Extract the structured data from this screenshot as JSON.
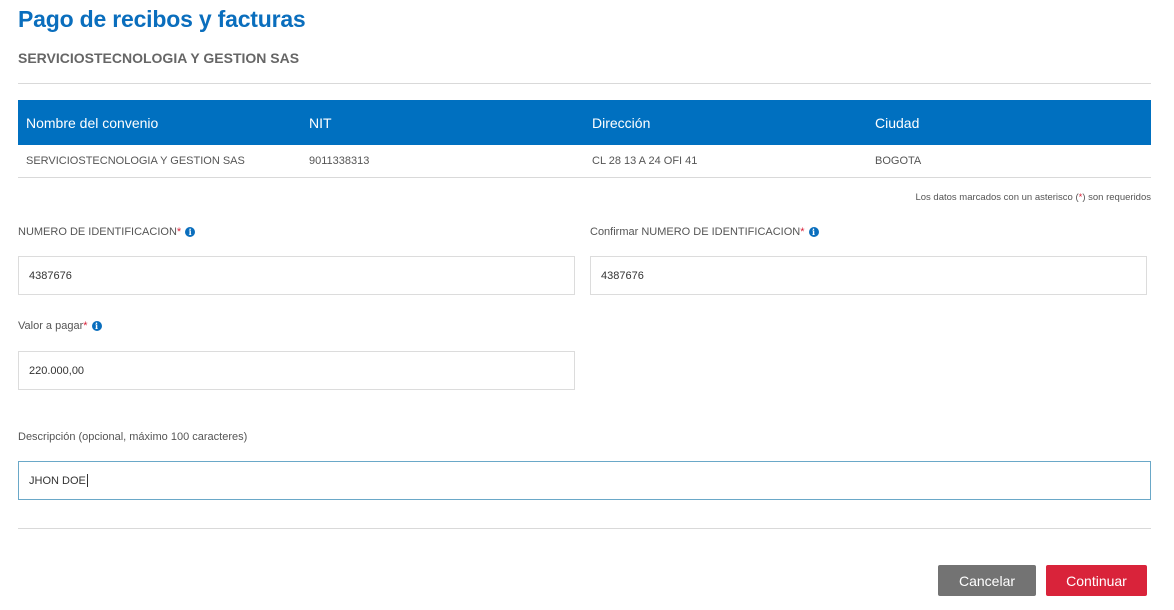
{
  "header": {
    "title": "Pago de recibos y facturas",
    "subtitle": "SERVICIOSTECNOLOGIA Y GESTION SAS"
  },
  "table": {
    "columns": [
      "Nombre del convenio",
      "NIT",
      "Dirección",
      "Ciudad"
    ],
    "rows": [
      [
        "SERVICIOSTECNOLOGIA Y GESTION SAS",
        "9011338313",
        "CL 28 13 A 24 OFI 41",
        "BOGOTA"
      ]
    ]
  },
  "required_note": {
    "before": "Los datos marcados con un asterisco (",
    "star": "*",
    "after": ") son requeridos"
  },
  "form": {
    "id_number": {
      "label": "NUMERO DE IDENTIFICACION",
      "star": "*",
      "value": "4387676"
    },
    "confirm_id_number": {
      "label": "Confirmar NUMERO DE IDENTIFICACION",
      "star": "*",
      "value": "4387676"
    },
    "amount": {
      "label": "Valor a pagar",
      "star": "*",
      "value": "220.000,00"
    },
    "description": {
      "label": "Descripción (opcional, máximo 100 caracteres)",
      "value": "JHON DOE"
    }
  },
  "icons": {
    "info": "i"
  },
  "buttons": {
    "cancel": "Cancelar",
    "continue": "Continuar"
  },
  "colors": {
    "brand_blue": "#0070c0",
    "title_blue": "#0a6ebd",
    "continue_red": "#d9233a",
    "cancel_gray": "#737373"
  }
}
